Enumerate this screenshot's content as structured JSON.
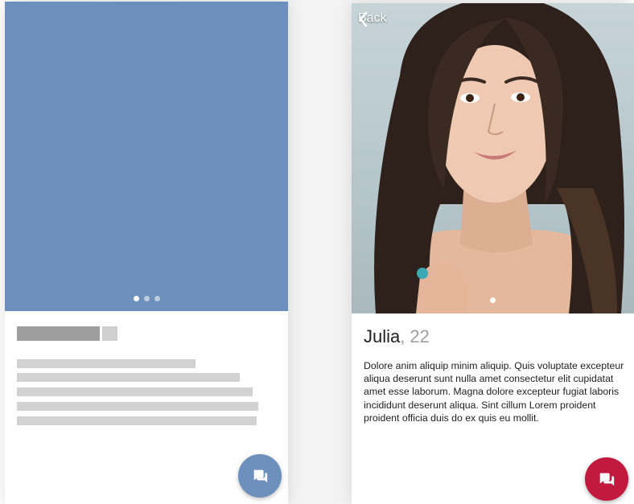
{
  "skeleton_card": {
    "photo_color": "#6c8fbc",
    "carousel_dots": 3,
    "active_dot": 0,
    "chat_button_icon": "chat-bubbles-icon"
  },
  "profile": {
    "back_label": "Back",
    "name": "Julia",
    "separator": ",",
    "age": "22",
    "bio": "Dolore anim aliquip minim aliquip. Quis voluptate excepteur aliqua deserunt sunt nulla amet consectetur elit cupidatat amet esse laborum. Magna dolore excepteur fugiat laboris incididunt deserunt aliqua. Sint cillum Lorem proident proident officia duis do ex quis eu mollit.",
    "carousel_dots": 1,
    "active_dot": 0,
    "chat_button_icon": "chat-bubbles-icon",
    "accent_color": "#c2193e"
  }
}
